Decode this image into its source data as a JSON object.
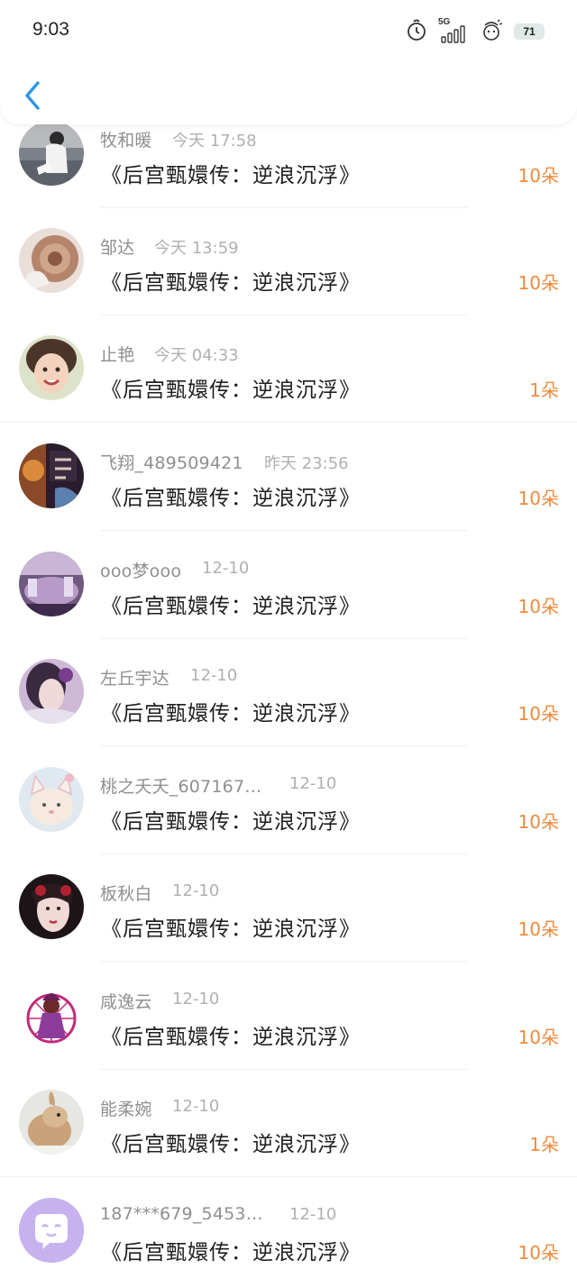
{
  "status_bar": {
    "time": "9:03",
    "network": "5G",
    "battery": "71"
  },
  "header": {
    "back_icon": "chevron-left-icon",
    "accent_color": "#2f95e6"
  },
  "gift_count_color": "#f08a3c",
  "rows": [
    {
      "name": "牧和暖",
      "time": "今天 17:58",
      "title": "《后宫甄嬛传：逆浪沉浮》",
      "count": "10朵"
    },
    {
      "name": "邹达",
      "time": "今天 13:59",
      "title": "《后宫甄嬛传：逆浪沉浮》",
      "count": "10朵"
    },
    {
      "name": "止艳",
      "time": "今天 04:33",
      "title": "《后宫甄嬛传：逆浪沉浮》",
      "count": "1朵"
    },
    {
      "name": "飞翔_489509421",
      "time": "昨天 23:56",
      "title": "《后宫甄嬛传：逆浪沉浮》",
      "count": "10朵"
    },
    {
      "name": "ooo梦ooo",
      "time": "12-10",
      "title": "《后宫甄嬛传：逆浪沉浮》",
      "count": "10朵"
    },
    {
      "name": "左丘宇达",
      "time": "12-10",
      "title": "《后宫甄嬛传：逆浪沉浮》",
      "count": "10朵"
    },
    {
      "name": "桃之夭夭_607167…",
      "time": "12-10",
      "title": "《后宫甄嬛传：逆浪沉浮》",
      "count": "10朵"
    },
    {
      "name": "板秋白",
      "time": "12-10",
      "title": "《后宫甄嬛传：逆浪沉浮》",
      "count": "10朵"
    },
    {
      "name": "咸逸云",
      "time": "12-10",
      "title": "《后宫甄嬛传：逆浪沉浮》",
      "count": "10朵"
    },
    {
      "name": "能柔婉",
      "time": "12-10",
      "title": "《后宫甄嬛传：逆浪沉浮》",
      "count": "1朵"
    },
    {
      "name": "187***679_5453…",
      "time": "12-10",
      "title": "《后宫甄嬛传：逆浪沉浮》",
      "count": "10朵"
    }
  ]
}
